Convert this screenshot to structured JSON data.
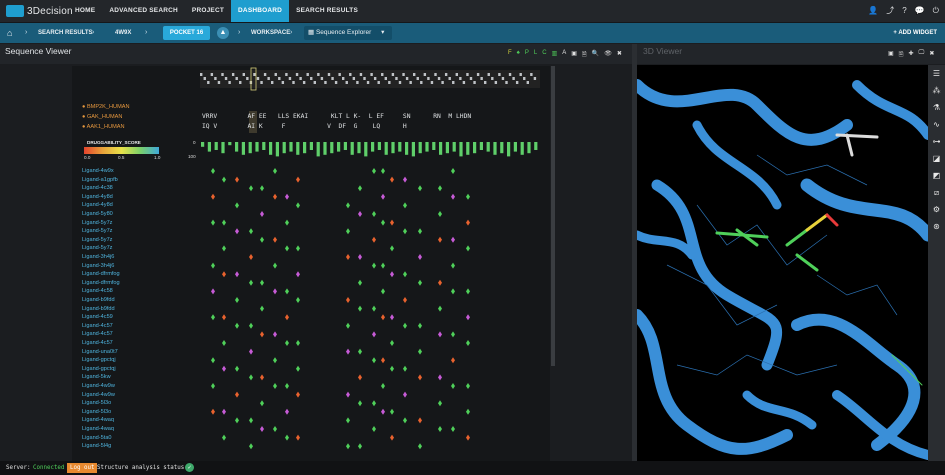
{
  "app": {
    "logo_text": "3Decision"
  },
  "nav": {
    "items": [
      "HOME",
      "ADVANCED SEARCH",
      "PROJECT",
      "DASHBOARD",
      "SEARCH RESULTS"
    ],
    "active": "DASHBOARD"
  },
  "breadcrumb": {
    "home_icon": "home-icon",
    "search_results": "SEARCH RESULTS",
    "structure": "4W9X",
    "pocket": "POCKET 16",
    "workspace": "WORKSPACE",
    "explorer": "Sequence Explorer",
    "add_widget": "+ ADD WIDGET"
  },
  "panels": {
    "sequence_viewer": "Sequence Viewer",
    "viewer_3d": "3D Viewer",
    "seq_tools": [
      "F",
      "♠",
      "P",
      "L",
      "C",
      "▥",
      "A",
      "▣",
      "🗎",
      "🔍",
      "👁",
      "✖"
    ],
    "viewer_tools": [
      "▣",
      "🗎",
      "✚",
      "🖵",
      "✖"
    ]
  },
  "proteins": [
    "BMP2K_HUMAN",
    "GAK_HUMAN",
    "AAK1_HUMAN"
  ],
  "residues": {
    "row1": "VRRV        AF EE   LLS EKAI      KLT L K-  L EF     SN      RN  M LHDN",
    "row2": "IQ V        AI K     F           V  DF  G    LQ      H"
  },
  "legend": {
    "title": "DRUGGABILITY_SCORE",
    "ticks": [
      "0.0",
      "0.5",
      "1.0"
    ],
    "bar_max": "100",
    "bar_min": "0"
  },
  "ligands": [
    "Ligand-4w9x",
    "Ligand-a1gpfb",
    "Ligand-4c38",
    "Ligand-4y8d",
    "Ligand-4y8d",
    "Ligand-5y80",
    "Ligand-5y7z",
    "Ligand-5y7z",
    "Ligand-5y7z",
    "Ligand-5y7z",
    "Ligand-3h4j6",
    "Ligand-3h4j6",
    "Ligand-dfrmfog",
    "Ligand-dfrmfog",
    "Ligand-4c58",
    "Ligand-b9fdd",
    "Ligand-b9fdd",
    "Ligand-4c59",
    "Ligand-4c57",
    "Ligand-4c57",
    "Ligand-4c57",
    "Ligand-una0t7",
    "Ligand-gpctqj",
    "Ligand-gpctqj",
    "Ligand-5kw",
    "Ligand-4w9w",
    "Ligand-4w9w",
    "Ligand-5l3o",
    "Ligand-5l3o",
    "Ligand-4waq",
    "Ligand-4waq",
    "Ligand-5ta0",
    "Ligand-5l4g"
  ],
  "status": {
    "server_label": "Server:",
    "server_value": "Connected",
    "logout": "Log out",
    "analysis_label": "Structure analysis status:",
    "analysis_icon": "check-icon"
  },
  "colors": {
    "accent": "#1f9ecf",
    "ligand_green": "#4fd05a",
    "ligand_orange": "#e8622e",
    "ligand_purple": "#c65bd6",
    "ribbon": "#2f8ad8"
  }
}
